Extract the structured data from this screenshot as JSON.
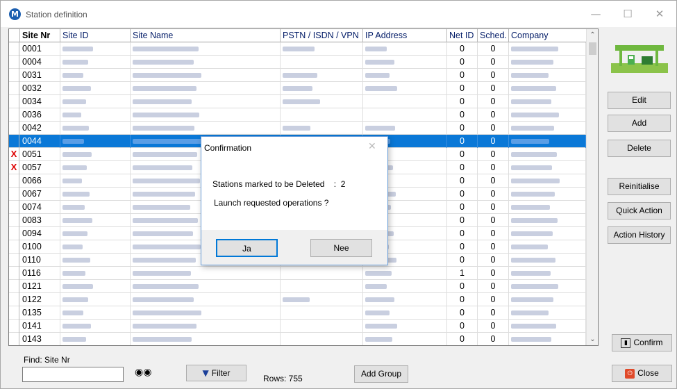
{
  "window": {
    "title": "Station definition",
    "app_icon_letter": "M"
  },
  "grid": {
    "columns": [
      "Site Nr",
      "Site ID",
      "Site Name",
      "PSTN / ISDN / VPN",
      "IP Address",
      "Net ID",
      "Sched.",
      "Company"
    ],
    "rows": [
      {
        "marker": "",
        "site_nr": "0001",
        "net_id": "0",
        "sched": "0"
      },
      {
        "marker": "",
        "site_nr": "0004",
        "net_id": "0",
        "sched": "0"
      },
      {
        "marker": "",
        "site_nr": "0031",
        "net_id": "0",
        "sched": "0"
      },
      {
        "marker": "",
        "site_nr": "0032",
        "net_id": "0",
        "sched": "0"
      },
      {
        "marker": "",
        "site_nr": "0034",
        "net_id": "0",
        "sched": "0"
      },
      {
        "marker": "",
        "site_nr": "0036",
        "net_id": "0",
        "sched": "0"
      },
      {
        "marker": "",
        "site_nr": "0042",
        "net_id": "0",
        "sched": "0"
      },
      {
        "marker": "",
        "site_nr": "0044",
        "net_id": "0",
        "sched": "0",
        "selected": true
      },
      {
        "marker": "X",
        "site_nr": "0051",
        "net_id": "0",
        "sched": "0"
      },
      {
        "marker": "X",
        "site_nr": "0057",
        "net_id": "0",
        "sched": "0"
      },
      {
        "marker": "",
        "site_nr": "0066",
        "net_id": "0",
        "sched": "0"
      },
      {
        "marker": "",
        "site_nr": "0067",
        "net_id": "0",
        "sched": "0"
      },
      {
        "marker": "",
        "site_nr": "0074",
        "net_id": "0",
        "sched": "0"
      },
      {
        "marker": "",
        "site_nr": "0083",
        "net_id": "0",
        "sched": "0"
      },
      {
        "marker": "",
        "site_nr": "0094",
        "net_id": "0",
        "sched": "0"
      },
      {
        "marker": "",
        "site_nr": "0100",
        "net_id": "0",
        "sched": "0"
      },
      {
        "marker": "",
        "site_nr": "0110",
        "net_id": "0",
        "sched": "0"
      },
      {
        "marker": "",
        "site_nr": "0116",
        "net_id": "1",
        "sched": "0"
      },
      {
        "marker": "",
        "site_nr": "0121",
        "net_id": "0",
        "sched": "0"
      },
      {
        "marker": "",
        "site_nr": "0122",
        "net_id": "0",
        "sched": "0"
      },
      {
        "marker": "",
        "site_nr": "0135",
        "net_id": "0",
        "sched": "0"
      },
      {
        "marker": "",
        "site_nr": "0141",
        "net_id": "0",
        "sched": "0"
      },
      {
        "marker": "",
        "site_nr": "0143",
        "net_id": "0",
        "sched": "0"
      }
    ]
  },
  "side_buttons": {
    "edit": "Edit",
    "add": "Add",
    "delete": "Delete",
    "reinitialise": "Reinitialise",
    "quick_action": "Quick Action",
    "action_history": "Action History",
    "confirm": "Confirm",
    "close": "Close"
  },
  "bottom": {
    "find_label": "Find: Site Nr",
    "find_value": "",
    "filter_label": "Filter",
    "rows_label": "Rows: 755",
    "add_group_label": "Add Group"
  },
  "dialog": {
    "title": "Confirmation",
    "message_line1": "Stations marked to be Deleted    :  2",
    "message_line2": "Launch requested operations ?",
    "yes_label": "Ja",
    "no_label": "Nee"
  },
  "colors": {
    "selection": "#0a78d7",
    "delete_marker": "#d00000"
  }
}
